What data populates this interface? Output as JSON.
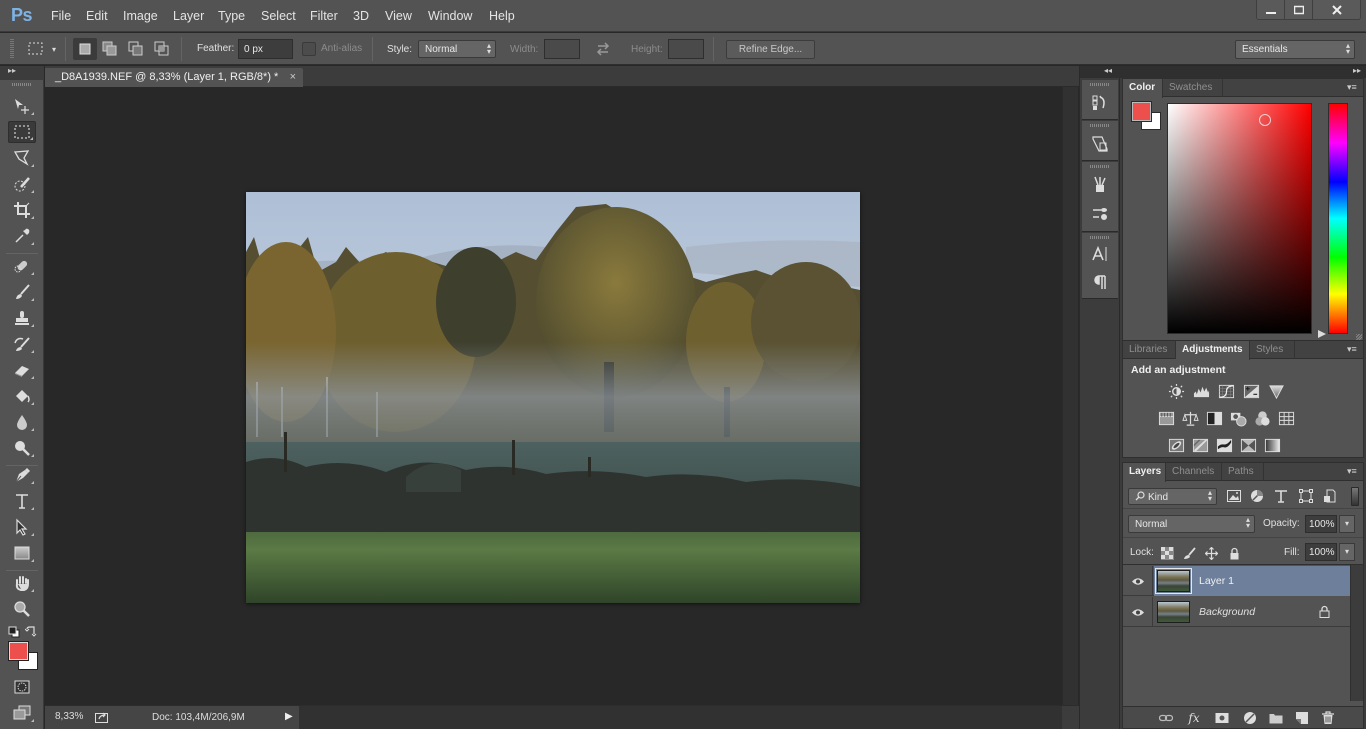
{
  "app": {
    "logo": "Ps",
    "menu": [
      "File",
      "Edit",
      "Image",
      "Layer",
      "Type",
      "Select",
      "Filter",
      "3D",
      "View",
      "Window",
      "Help"
    ],
    "window_controls": {
      "minimize": "—",
      "maximize": "▫",
      "close": "✕"
    }
  },
  "options_bar": {
    "feather_label": "Feather:",
    "feather_value": "0 px",
    "anti_alias_label": "Anti-alias",
    "anti_alias_checked": false,
    "style_label": "Style:",
    "style_value": "Normal",
    "width_label": "Width:",
    "width_value": "",
    "height_label": "Height:",
    "height_value": "",
    "refine_edge_label": "Refine Edge...",
    "workspace_value": "Essentials"
  },
  "document": {
    "tab_title": "_D8A1939.NEF @ 8,33% (Layer 1, RGB/8*) *",
    "tab_close": "×",
    "image_description": "Misty autumn field with large oak tree and birch forest"
  },
  "status_bar": {
    "zoom": "8,33%",
    "doc_info": "Doc: 103,4M/206,9M",
    "menu_arrow": "▶"
  },
  "toolbar": {
    "expand": "▸▸",
    "tools": [
      {
        "name": "move-tool",
        "active": false
      },
      {
        "name": "rectangular-marquee-tool",
        "active": true
      },
      {
        "name": "polygonal-lasso-tool",
        "active": false
      },
      {
        "name": "quick-selection-tool",
        "active": false
      },
      {
        "name": "crop-tool",
        "active": false
      },
      {
        "name": "eyedropper-tool",
        "active": false
      },
      {
        "name": "spot-healing-brush-tool",
        "active": false
      },
      {
        "name": "brush-tool",
        "active": false
      },
      {
        "name": "clone-stamp-tool",
        "active": false
      },
      {
        "name": "history-brush-tool",
        "active": false
      },
      {
        "name": "eraser-tool",
        "active": false
      },
      {
        "name": "paint-bucket-tool",
        "active": false
      },
      {
        "name": "blur-tool",
        "active": false
      },
      {
        "name": "dodge-tool",
        "active": false
      },
      {
        "name": "pen-tool",
        "active": false
      },
      {
        "name": "type-tool",
        "active": false
      },
      {
        "name": "path-selection-tool",
        "active": false
      },
      {
        "name": "rectangle-tool",
        "active": false
      },
      {
        "name": "hand-tool",
        "active": false
      },
      {
        "name": "zoom-tool",
        "active": false
      }
    ],
    "foreground_color": "#ed4f4d",
    "background_color": "#ffffff"
  },
  "icon_dock": {
    "collapse": "◂◂",
    "items": [
      "history-icon",
      "properties-icon",
      "brush-presets-icon",
      "brush-settings-icon",
      "character-icon",
      "paragraph-icon"
    ]
  },
  "panels": {
    "collapse": "▸▸",
    "color": {
      "tabs": [
        "Color",
        "Swatches"
      ],
      "active_tab": "Color",
      "foreground": "#ed4f4d",
      "background": "#ffffff",
      "hue": "#ff0000",
      "saturation": 0.67,
      "brightness": 0.93
    },
    "adjustments": {
      "tabs": [
        "Libraries",
        "Adjustments",
        "Styles"
      ],
      "active_tab": "Adjustments",
      "title": "Add an adjustment",
      "rows": [
        [
          "brightness-contrast",
          "levels",
          "curves",
          "exposure",
          "gradient-triangle"
        ],
        [
          "hue-saturation",
          "color-balance",
          "black-white",
          "photo-filter",
          "channel-mixer",
          "color-lookup"
        ],
        [
          "invert",
          "posterize",
          "threshold",
          "selective-color",
          "gradient-map"
        ]
      ]
    },
    "layers": {
      "tabs": [
        "Layers",
        "Channels",
        "Paths"
      ],
      "active_tab": "Layers",
      "filter_kind": "Kind",
      "blend_mode": "Normal",
      "opacity_label": "Opacity:",
      "opacity_value": "100%",
      "lock_label": "Lock:",
      "fill_label": "Fill:",
      "fill_value": "100%",
      "layers": [
        {
          "name": "Layer 1",
          "visible": true,
          "selected": true,
          "locked": false,
          "italic": false
        },
        {
          "name": "Background",
          "visible": true,
          "selected": false,
          "locked": true,
          "italic": true
        }
      ],
      "footer": [
        "link-layers",
        "fx",
        "add-mask",
        "adjustment-layer",
        "new-group",
        "new-layer",
        "delete-layer"
      ]
    }
  },
  "colors": {
    "ui_dark": "#282828",
    "ui_panel": "#535353",
    "selection": "#6d7f9b",
    "accent_logo": "#7fb3e6"
  }
}
